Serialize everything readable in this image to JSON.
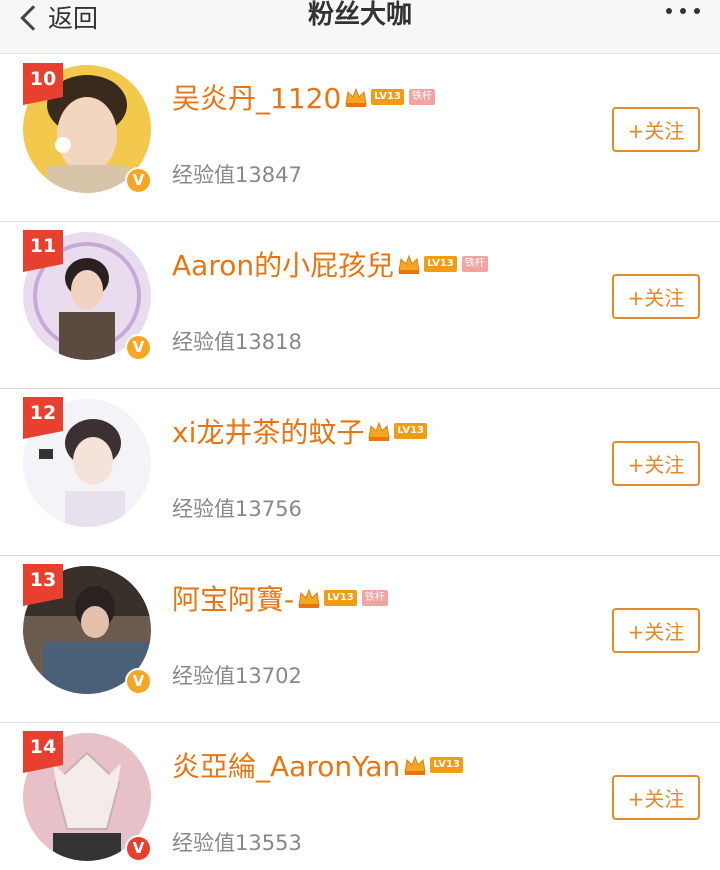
{
  "nav": {
    "back_label": "返回",
    "title": "粉丝大咖"
  },
  "follow_label": "+关注",
  "users": [
    {
      "rank": "10",
      "name": "吴炎丹_1120",
      "level": "LV13",
      "tag": "铁杆",
      "exp": "经验值13847",
      "badge": "V"
    },
    {
      "rank": "11",
      "name": "Aaron的小屁孩兒",
      "level": "LV13",
      "tag": "铁杆",
      "exp": "经验值13818",
      "badge": "V"
    },
    {
      "rank": "12",
      "name": "xi龙井茶的蚊子",
      "level": "LV13",
      "tag": "",
      "exp": "经验值13756",
      "badge": ""
    },
    {
      "rank": "13",
      "name": "阿宝阿寶-",
      "level": "LV13",
      "tag": "铁杆",
      "exp": "经验值13702",
      "badge": "V"
    },
    {
      "rank": "14",
      "name": "炎亞綸_AaronYan",
      "level": "LV13",
      "tag": "",
      "exp": "经验值13553",
      "badge": "V"
    }
  ],
  "colors": {
    "accent": "#e8750f",
    "rank_bg": "#e8402f",
    "follow_border": "#e38a2a"
  }
}
